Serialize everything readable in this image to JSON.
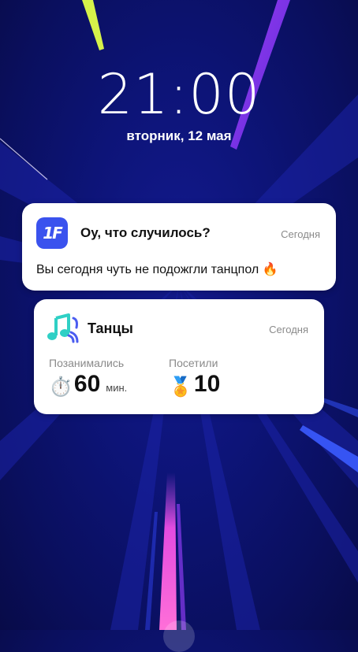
{
  "lockscreen": {
    "time": "21:00",
    "date": "вторник, 12 мая"
  },
  "notifications": [
    {
      "app_icon_text": "1F",
      "title": "Оу, что случилось?",
      "time": "Сегодня",
      "body": "Вы сегодня чуть не подожгли танцпол 🔥"
    },
    {
      "icon": "music-notes-icon",
      "title": "Танцы",
      "time": "Сегодня",
      "stats": [
        {
          "label": "Позанимались",
          "icon": "⏱️",
          "value": "60",
          "unit": "мин."
        },
        {
          "label": "Посетили",
          "icon": "🏅",
          "value": "10"
        }
      ]
    }
  ],
  "colors": {
    "background": "#0d1478",
    "card": "#ffffff",
    "app_icon": "#3a52ee",
    "music_icon_teal": "#2fd0c5",
    "music_icon_blue": "#4a5cf0"
  }
}
